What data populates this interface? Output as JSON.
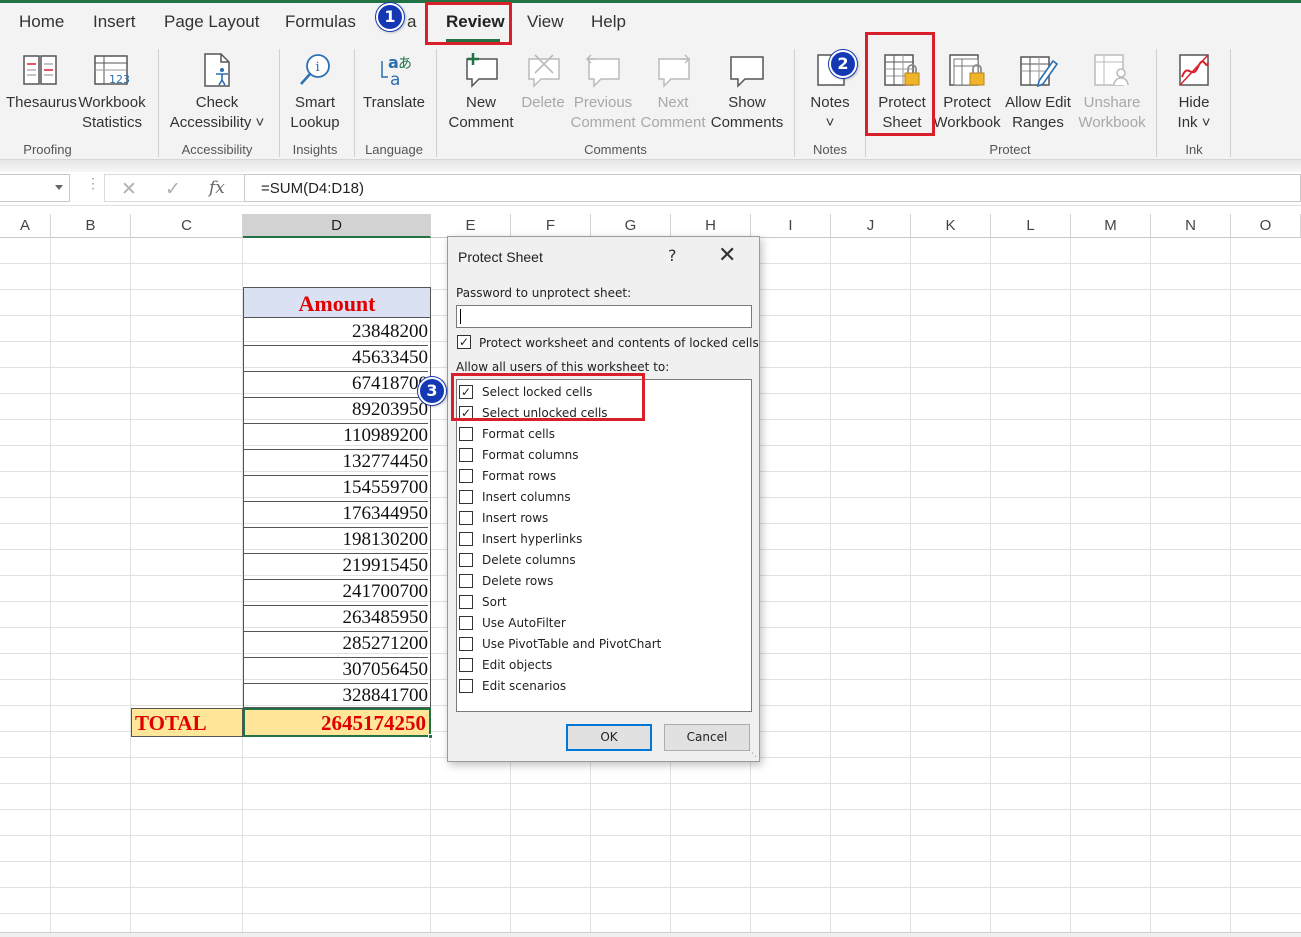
{
  "tabs": [
    "Home",
    "Insert",
    "Page Layout",
    "Formulas",
    "a",
    "Review",
    "View",
    "Help"
  ],
  "active_tab": "Review",
  "ribbon": {
    "thesaurus": "Thesaurus",
    "workbook_statistics": [
      "Workbook",
      "Statistics"
    ],
    "check_accessibility": [
      "Check",
      "Accessibility ˅"
    ],
    "smart_lookup": [
      "Smart",
      "Lookup"
    ],
    "translate": "Translate",
    "new_comment": [
      "New",
      "Comment"
    ],
    "delete": "Delete",
    "previous_comment": [
      "Previous",
      "Comment"
    ],
    "next_comment": [
      "Next",
      "Comment"
    ],
    "show_comments": [
      "Show",
      "Comments"
    ],
    "notes": "Notes",
    "notes_chevron": "˅",
    "protect_sheet": [
      "Protect",
      "Sheet"
    ],
    "protect_workbook": [
      "Protect",
      "Workbook"
    ],
    "allow_edit_ranges": [
      "Allow Edit",
      "Ranges"
    ],
    "unshare_workbook": [
      "Unshare",
      "Workbook"
    ],
    "hide_ink": [
      "Hide",
      "Ink ˅"
    ],
    "groups": [
      "Proofing",
      "Accessibility",
      "Insights",
      "Language",
      "Comments",
      "Notes",
      "Protect",
      "Ink"
    ]
  },
  "formula_bar": {
    "cancel_icon": "✕",
    "enter_icon": "✓",
    "fx_icon": "fx",
    "formula": "=SUM(D4:D18)"
  },
  "columns": [
    "A",
    "B",
    "C",
    "D",
    "E",
    "F",
    "G",
    "H",
    "I",
    "J",
    "K",
    "L",
    "M",
    "N",
    "O"
  ],
  "sheet": {
    "header": "Amount",
    "values": [
      "23848200",
      "45633450",
      "67418700",
      "89203950",
      "110989200",
      "132774450",
      "154559700",
      "176344950",
      "198130200",
      "219915450",
      "241700700",
      "263485950",
      "285271200",
      "307056450",
      "328841700"
    ],
    "total_label": "TOTAL",
    "total_value": "2645174250"
  },
  "dialog": {
    "title": "Protect Sheet",
    "help": "?",
    "close": "✕",
    "password_label": "Password to unprotect sheet:",
    "protect_contents_label": "Protect worksheet and contents of locked cells",
    "protect_contents_checked": true,
    "allow_label": "Allow all users of this worksheet to:",
    "options": [
      {
        "label": "Select locked cells",
        "checked": true
      },
      {
        "label": "Select unlocked cells",
        "checked": true
      },
      {
        "label": "Format cells",
        "checked": false
      },
      {
        "label": "Format columns",
        "checked": false
      },
      {
        "label": "Format rows",
        "checked": false
      },
      {
        "label": "Insert columns",
        "checked": false
      },
      {
        "label": "Insert rows",
        "checked": false
      },
      {
        "label": "Insert hyperlinks",
        "checked": false
      },
      {
        "label": "Delete columns",
        "checked": false
      },
      {
        "label": "Delete rows",
        "checked": false
      },
      {
        "label": "Sort",
        "checked": false
      },
      {
        "label": "Use AutoFilter",
        "checked": false
      },
      {
        "label": "Use PivotTable and PivotChart",
        "checked": false
      },
      {
        "label": "Edit objects",
        "checked": false
      },
      {
        "label": "Edit scenarios",
        "checked": false
      }
    ],
    "ok_label": "OK",
    "cancel_label": "Cancel"
  },
  "badges": [
    "1",
    "2",
    "3"
  ],
  "colors": {
    "accent": "#217346",
    "highlight": "#d9202a",
    "badge": "#1438b4",
    "total_fill": "#ffe699",
    "header_fill": "#d9e1f2",
    "red_text": "#e00000"
  }
}
